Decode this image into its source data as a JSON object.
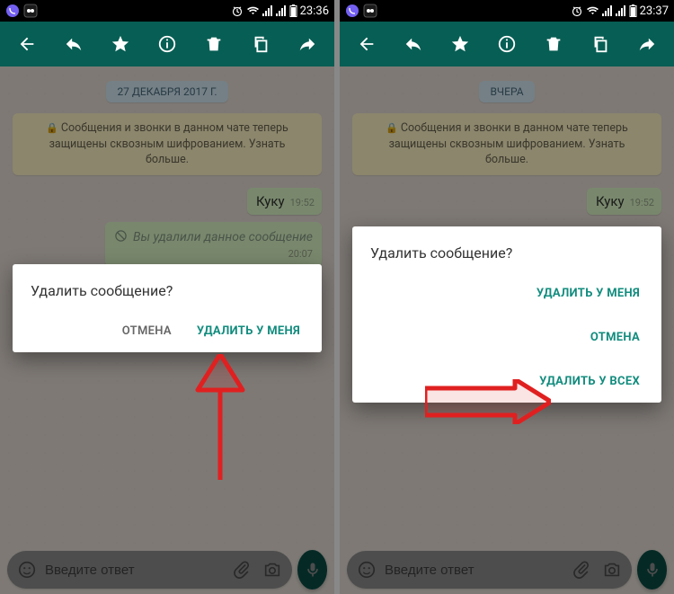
{
  "left": {
    "status": {
      "time": "23:36"
    },
    "date_label": "27 ДЕКАБРЯ 2017 Г.",
    "encryption": "Сообщения и звонки в данном чате теперь защищены сквозным шифрованием. Узнать больше.",
    "message1": {
      "text": "Куку",
      "time": "19:52"
    },
    "deleted": {
      "text": "Вы удалили данное сообщение",
      "time": "20:07"
    },
    "dialog": {
      "title": "Удалить сообщение?",
      "cancel": "ОТМЕНА",
      "delete_me": "УДАЛИТЬ У МЕНЯ"
    },
    "input_placeholder": "Введите ответ"
  },
  "right": {
    "status": {
      "time": "23:37"
    },
    "date_label": "ВЧЕРА",
    "encryption": "Сообщения и звонки в данном чате теперь защищены сквозным шифрованием. Узнать больше.",
    "message1": {
      "text": "Куку",
      "time": "19:52"
    },
    "dialog": {
      "title": "Удалить сообщение?",
      "delete_me": "УДАЛИТЬ У МЕНЯ",
      "cancel": "ОТМЕНА",
      "delete_all": "УДАЛИТЬ У ВСЕХ"
    },
    "input_placeholder": "Введите ответ"
  }
}
